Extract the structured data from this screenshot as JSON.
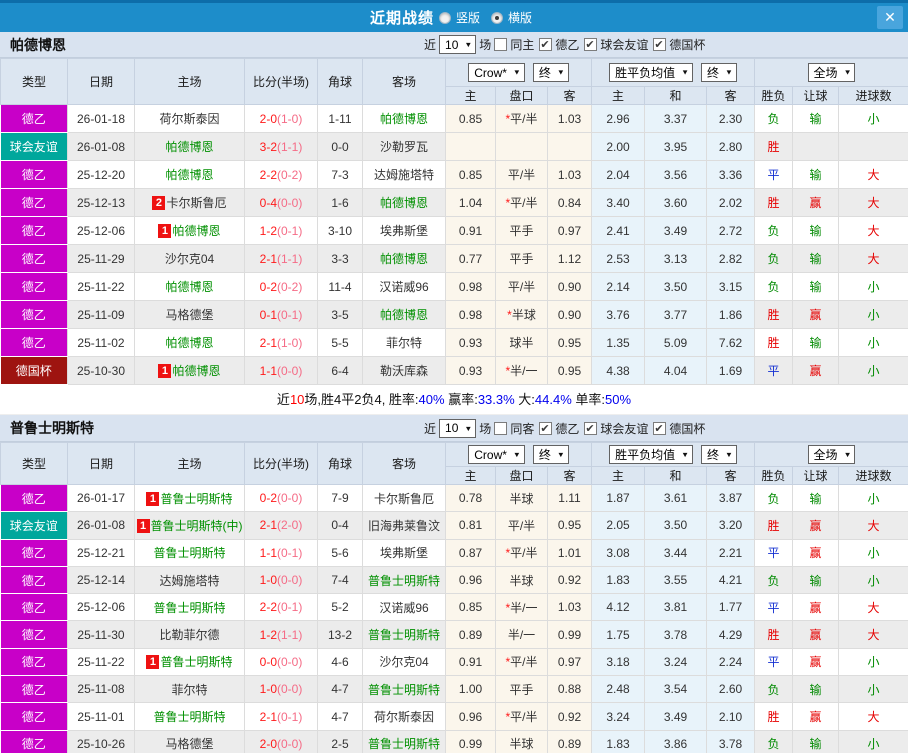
{
  "titlebar": {
    "title": "近期战绩",
    "close_icon": "✕",
    "radios": [
      {
        "label": "竖版",
        "selected": false
      },
      {
        "label": "横版",
        "selected": true
      }
    ]
  },
  "columns": {
    "type": "类型",
    "date": "日期",
    "home": "主场",
    "score": "比分(半场)",
    "corner": "角球",
    "away": "客场",
    "dd_crow": "Crow*",
    "dd_final": "终",
    "dd_mean": "胜平负均值",
    "dd_full": "全场",
    "odds_sub": [
      "主",
      "盘口",
      "客"
    ],
    "mean_sub": [
      "主",
      "和",
      "客"
    ],
    "result_sub": [
      "胜负",
      "让球",
      "进球数"
    ]
  },
  "colors": {
    "titlebar_blue": "#1d8dca",
    "league": {
      "德乙": "#c800c8",
      "球会友谊": "#00a79c",
      "德国杯": "#9e1410"
    },
    "outcome": {
      "胜": "#e60000",
      "平": "#1430d2",
      "负": "#008a00",
      "赢": "#e60000",
      "输": "#008a00",
      "大": "#e60000",
      "小": "#008a00"
    },
    "score": "#ff1a1a",
    "score_half": "#f56b86",
    "badge": "#ee1111",
    "percent": "#0000ee"
  },
  "sections": [
    {
      "team": "帕德博恩",
      "filter": {
        "near": "近",
        "count": "10",
        "games": "场",
        "same": "同主",
        "same_checked": false,
        "leagues": [
          {
            "label": "德乙",
            "checked": true
          },
          {
            "label": "球会友谊",
            "checked": true
          },
          {
            "label": "德国杯",
            "checked": true
          }
        ]
      },
      "rows": [
        {
          "lg": "德乙",
          "date": "26-01-18",
          "home": {
            "n": "荷尔斯泰因"
          },
          "sc": "2-0",
          "hf": "(1-0)",
          "cr": "1-11",
          "away": {
            "n": "帕德博恩",
            "self": true
          },
          "od": [
            "0.85",
            "*平/半",
            "1.03"
          ],
          "mn": [
            "2.96",
            "3.37",
            "2.30"
          ],
          "rs": [
            "负",
            "输",
            "小"
          ]
        },
        {
          "lg": "球会友谊",
          "date": "26-01-08",
          "home": {
            "n": "帕德博恩",
            "self": true
          },
          "sc": "3-2",
          "hf": "(1-1)",
          "cr": "0-0",
          "away": {
            "n": "沙勒罗瓦"
          },
          "od": [
            "",
            "",
            ""
          ],
          "mn": [
            "2.00",
            "3.95",
            "2.80"
          ],
          "rs": [
            "胜",
            "",
            ""
          ]
        },
        {
          "lg": "德乙",
          "date": "25-12-20",
          "home": {
            "n": "帕德博恩",
            "self": true
          },
          "sc": "2-2",
          "hf": "(0-2)",
          "cr": "7-3",
          "away": {
            "n": "达姆施塔特"
          },
          "od": [
            "0.85",
            "平/半",
            "1.03"
          ],
          "mn": [
            "2.04",
            "3.56",
            "3.36"
          ],
          "rs": [
            "平",
            "输",
            "大"
          ]
        },
        {
          "lg": "德乙",
          "date": "25-12-13",
          "home": {
            "n": "卡尔斯鲁厄",
            "badge": "2"
          },
          "sc": "0-4",
          "hf": "(0-0)",
          "cr": "1-6",
          "away": {
            "n": "帕德博恩",
            "self": true
          },
          "od": [
            "1.04",
            "*平/半",
            "0.84"
          ],
          "mn": [
            "3.40",
            "3.60",
            "2.02"
          ],
          "rs": [
            "胜",
            "赢",
            "大"
          ]
        },
        {
          "lg": "德乙",
          "date": "25-12-06",
          "home": {
            "n": "帕德博恩",
            "self": true,
            "badge": "1"
          },
          "sc": "1-2",
          "hf": "(0-1)",
          "cr": "3-10",
          "away": {
            "n": "埃弗斯堡"
          },
          "od": [
            "0.91",
            "平手",
            "0.97"
          ],
          "mn": [
            "2.41",
            "3.49",
            "2.72"
          ],
          "rs": [
            "负",
            "输",
            "大"
          ]
        },
        {
          "lg": "德乙",
          "date": "25-11-29",
          "home": {
            "n": "沙尔克04"
          },
          "sc": "2-1",
          "hf": "(1-1)",
          "cr": "3-3",
          "away": {
            "n": "帕德博恩",
            "self": true
          },
          "od": [
            "0.77",
            "平手",
            "1.12"
          ],
          "mn": [
            "2.53",
            "3.13",
            "2.82"
          ],
          "rs": [
            "负",
            "输",
            "大"
          ]
        },
        {
          "lg": "德乙",
          "date": "25-11-22",
          "home": {
            "n": "帕德博恩",
            "self": true
          },
          "sc": "0-2",
          "hf": "(0-2)",
          "cr": "11-4",
          "away": {
            "n": "汉诺威96"
          },
          "od": [
            "0.98",
            "平/半",
            "0.90"
          ],
          "mn": [
            "2.14",
            "3.50",
            "3.15"
          ],
          "rs": [
            "负",
            "输",
            "小"
          ]
        },
        {
          "lg": "德乙",
          "date": "25-11-09",
          "home": {
            "n": "马格德堡"
          },
          "sc": "0-1",
          "hf": "(0-1)",
          "cr": "3-5",
          "away": {
            "n": "帕德博恩",
            "self": true
          },
          "od": [
            "0.98",
            "*半球",
            "0.90"
          ],
          "mn": [
            "3.76",
            "3.77",
            "1.86"
          ],
          "rs": [
            "胜",
            "赢",
            "小"
          ]
        },
        {
          "lg": "德乙",
          "date": "25-11-02",
          "home": {
            "n": "帕德博恩",
            "self": true
          },
          "sc": "2-1",
          "hf": "(1-0)",
          "cr": "5-5",
          "away": {
            "n": "菲尔特"
          },
          "od": [
            "0.93",
            "球半",
            "0.95"
          ],
          "mn": [
            "1.35",
            "5.09",
            "7.62"
          ],
          "rs": [
            "胜",
            "输",
            "小"
          ]
        },
        {
          "lg": "德国杯",
          "date": "25-10-30",
          "home": {
            "n": "帕德博恩",
            "self": true,
            "badge": "1"
          },
          "sc": "1-1",
          "hf": "(0-0)",
          "cr": "6-4",
          "away": {
            "n": "勒沃库森"
          },
          "od": [
            "0.93",
            "*半/一",
            "0.95"
          ],
          "mn": [
            "4.38",
            "4.04",
            "1.69"
          ],
          "rs": [
            "平",
            "赢",
            "小"
          ]
        }
      ],
      "summary": [
        {
          "text": "近"
        },
        {
          "text": "10",
          "color": "#ff0000"
        },
        {
          "text": "场,胜4平2负4, 胜率:"
        },
        {
          "text": "40%",
          "color": "#0000ee"
        },
        {
          "text": " 赢率:"
        },
        {
          "text": "33.3%",
          "color": "#0000ee"
        },
        {
          "text": " 大:"
        },
        {
          "text": "44.4%",
          "color": "#0000ee"
        },
        {
          "text": " 单率:"
        },
        {
          "text": "50%",
          "color": "#0000ee"
        }
      ]
    },
    {
      "team": "普鲁士明斯特",
      "filter": {
        "near": "近",
        "count": "10",
        "games": "场",
        "same": "同客",
        "same_checked": false,
        "leagues": [
          {
            "label": "德乙",
            "checked": true
          },
          {
            "label": "球会友谊",
            "checked": true
          },
          {
            "label": "德国杯",
            "checked": true
          }
        ]
      },
      "rows": [
        {
          "lg": "德乙",
          "date": "26-01-17",
          "home": {
            "n": "普鲁士明斯特",
            "self": true,
            "badge": "1"
          },
          "sc": "0-2",
          "hf": "(0-0)",
          "cr": "7-9",
          "away": {
            "n": "卡尔斯鲁厄"
          },
          "od": [
            "0.78",
            "半球",
            "1.11"
          ],
          "mn": [
            "1.87",
            "3.61",
            "3.87"
          ],
          "rs": [
            "负",
            "输",
            "小"
          ]
        },
        {
          "lg": "球会友谊",
          "date": "26-01-08",
          "home": {
            "n": "普鲁士明斯特(中)",
            "self": true,
            "badge": "1"
          },
          "sc": "2-1",
          "hf": "(2-0)",
          "cr": "0-4",
          "away": {
            "n": "旧海弗莱鲁汶"
          },
          "od": [
            "0.81",
            "平/半",
            "0.95"
          ],
          "mn": [
            "2.05",
            "3.50",
            "3.20"
          ],
          "rs": [
            "胜",
            "赢",
            "大"
          ]
        },
        {
          "lg": "德乙",
          "date": "25-12-21",
          "home": {
            "n": "普鲁士明斯特",
            "self": true
          },
          "sc": "1-1",
          "hf": "(0-1)",
          "cr": "5-6",
          "away": {
            "n": "埃弗斯堡"
          },
          "od": [
            "0.87",
            "*平/半",
            "1.01"
          ],
          "mn": [
            "3.08",
            "3.44",
            "2.21"
          ],
          "rs": [
            "平",
            "赢",
            "小"
          ]
        },
        {
          "lg": "德乙",
          "date": "25-12-14",
          "home": {
            "n": "达姆施塔特"
          },
          "sc": "1-0",
          "hf": "(0-0)",
          "cr": "7-4",
          "away": {
            "n": "普鲁士明斯特",
            "self": true
          },
          "od": [
            "0.96",
            "半球",
            "0.92"
          ],
          "mn": [
            "1.83",
            "3.55",
            "4.21"
          ],
          "rs": [
            "负",
            "输",
            "小"
          ]
        },
        {
          "lg": "德乙",
          "date": "25-12-06",
          "home": {
            "n": "普鲁士明斯特",
            "self": true
          },
          "sc": "2-2",
          "hf": "(0-1)",
          "cr": "5-2",
          "away": {
            "n": "汉诺威96"
          },
          "od": [
            "0.85",
            "*半/一",
            "1.03"
          ],
          "mn": [
            "4.12",
            "3.81",
            "1.77"
          ],
          "rs": [
            "平",
            "赢",
            "大"
          ]
        },
        {
          "lg": "德乙",
          "date": "25-11-30",
          "home": {
            "n": "比勒菲尔德"
          },
          "sc": "1-2",
          "hf": "(1-1)",
          "cr": "13-2",
          "away": {
            "n": "普鲁士明斯特",
            "self": true
          },
          "od": [
            "0.89",
            "半/一",
            "0.99"
          ],
          "mn": [
            "1.75",
            "3.78",
            "4.29"
          ],
          "rs": [
            "胜",
            "赢",
            "大"
          ]
        },
        {
          "lg": "德乙",
          "date": "25-11-22",
          "home": {
            "n": "普鲁士明斯特",
            "self": true,
            "badge": "1"
          },
          "sc": "0-0",
          "hf": "(0-0)",
          "cr": "4-6",
          "away": {
            "n": "沙尔克04"
          },
          "od": [
            "0.91",
            "*平/半",
            "0.97"
          ],
          "mn": [
            "3.18",
            "3.24",
            "2.24"
          ],
          "rs": [
            "平",
            "赢",
            "小"
          ]
        },
        {
          "lg": "德乙",
          "date": "25-11-08",
          "home": {
            "n": "菲尔特"
          },
          "sc": "1-0",
          "hf": "(0-0)",
          "cr": "4-7",
          "away": {
            "n": "普鲁士明斯特",
            "self": true
          },
          "od": [
            "1.00",
            "平手",
            "0.88"
          ],
          "mn": [
            "2.48",
            "3.54",
            "2.60"
          ],
          "rs": [
            "负",
            "输",
            "小"
          ]
        },
        {
          "lg": "德乙",
          "date": "25-11-01",
          "home": {
            "n": "普鲁士明斯特",
            "self": true
          },
          "sc": "2-1",
          "hf": "(0-1)",
          "cr": "4-7",
          "away": {
            "n": "荷尔斯泰因"
          },
          "od": [
            "0.96",
            "*平/半",
            "0.92"
          ],
          "mn": [
            "3.24",
            "3.49",
            "2.10"
          ],
          "rs": [
            "胜",
            "赢",
            "大"
          ]
        },
        {
          "lg": "德乙",
          "date": "25-10-26",
          "home": {
            "n": "马格德堡"
          },
          "sc": "2-0",
          "hf": "(0-0)",
          "cr": "2-5",
          "away": {
            "n": "普鲁士明斯特",
            "self": true
          },
          "od": [
            "0.99",
            "半球",
            "0.89"
          ],
          "mn": [
            "1.83",
            "3.86",
            "3.78"
          ],
          "rs": [
            "负",
            "输",
            "小"
          ]
        }
      ],
      "summary": null
    }
  ]
}
